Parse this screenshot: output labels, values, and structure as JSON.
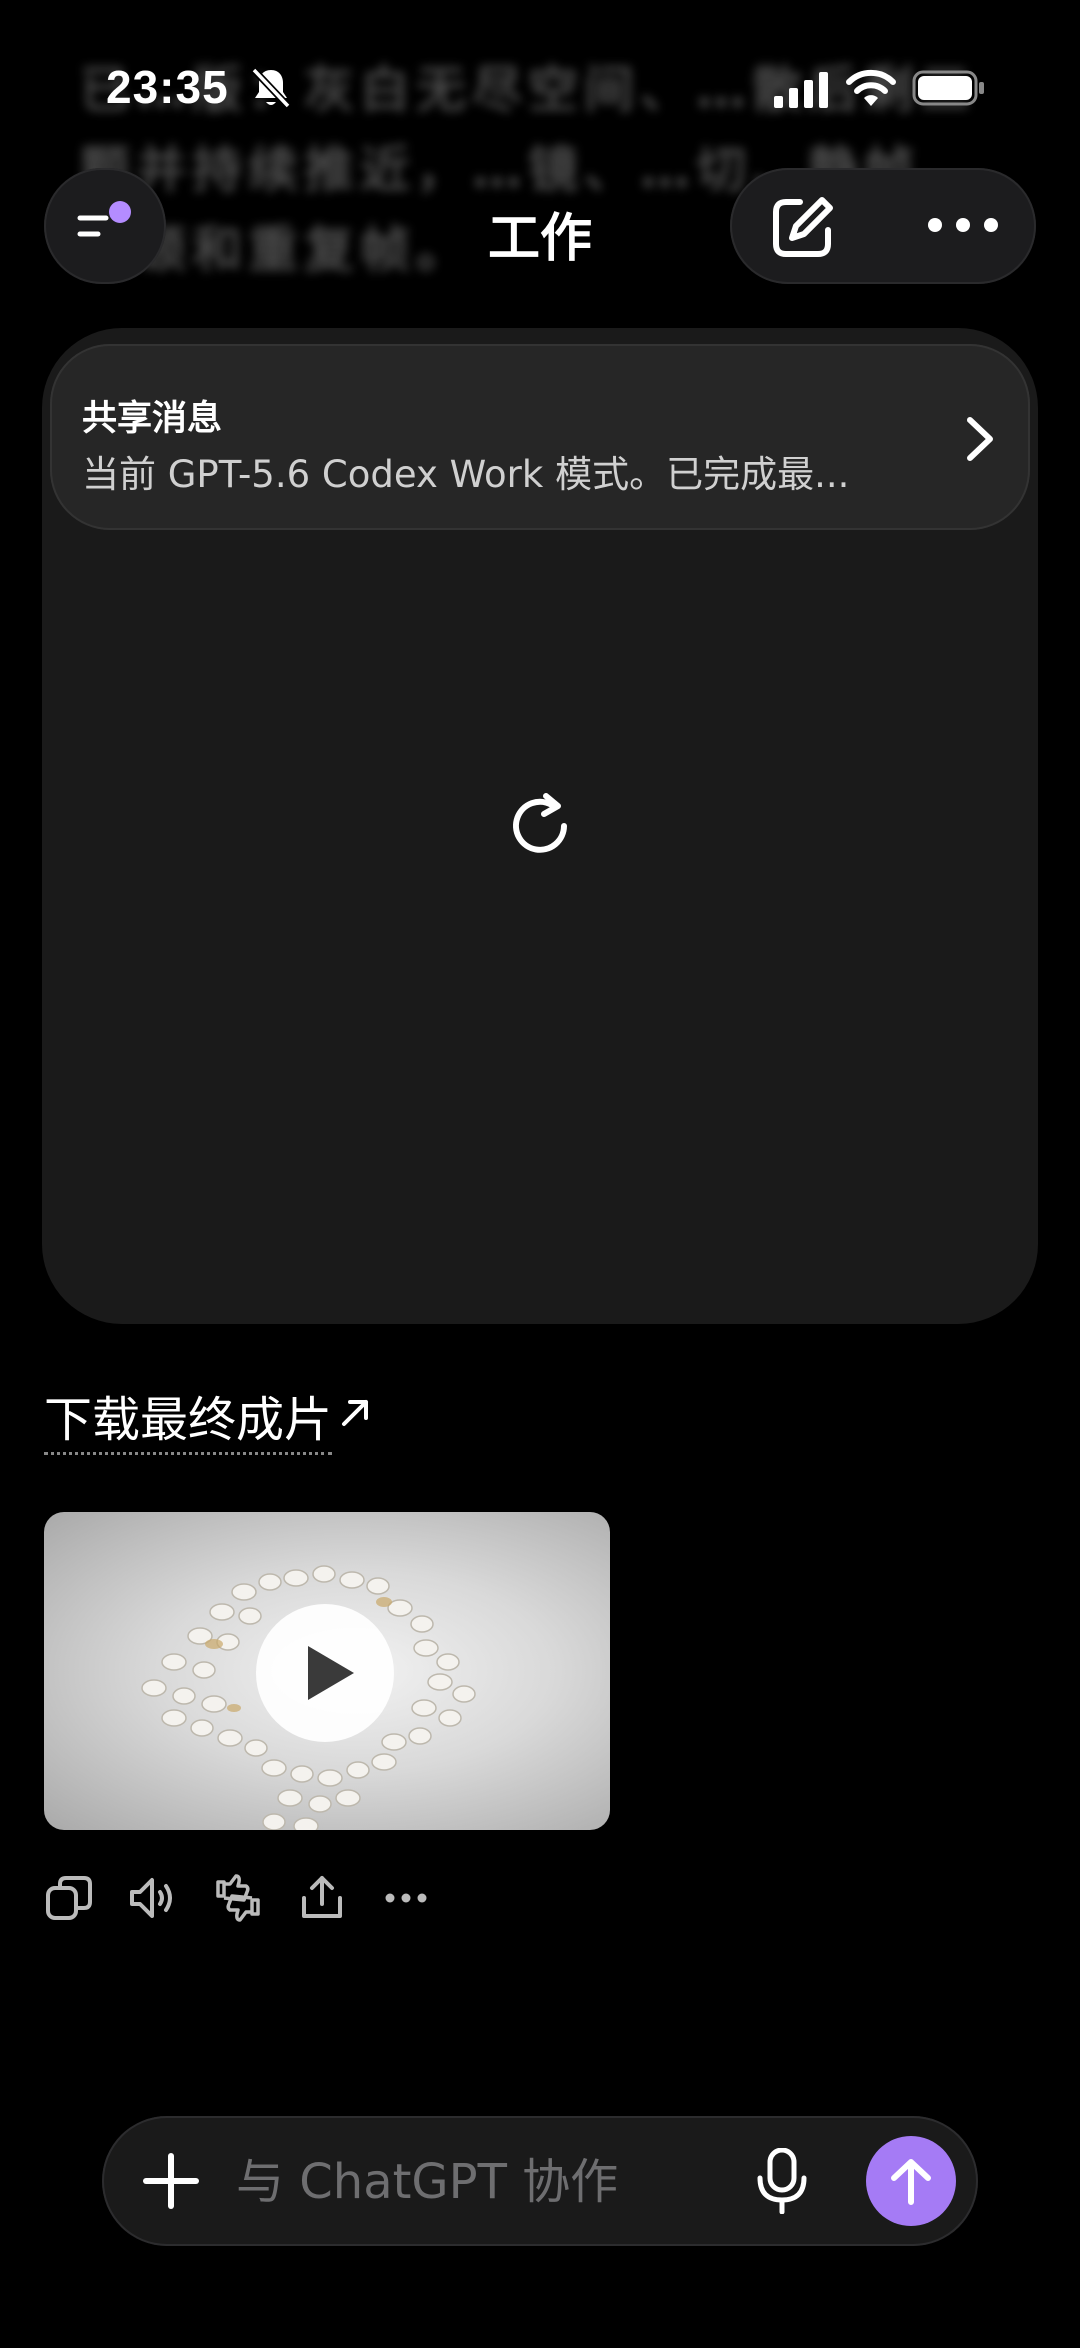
{
  "status_bar": {
    "time": "23:35",
    "icons": [
      "bell-off-icon",
      "signal-icon",
      "wifi-icon",
      "battery-icon"
    ]
  },
  "background_text": "已…版：灰白无尽空间、…散后剩三颗并持续推近，…镜、…切、静帧、卡顿和重复帧。",
  "header": {
    "title": "工作",
    "menu_icon": "menu-icon",
    "compose_icon": "compose-icon",
    "more_icon": "more-icon",
    "accent_color": "#b48cff"
  },
  "shared_message": {
    "title": "共享消息",
    "preview": "当前 GPT-5.6 Codex Work 模式。已完成最..."
  },
  "download": {
    "label": "下载最终成片",
    "icon": "arrow-up-right-icon"
  },
  "actions": [
    "copy-icon",
    "speaker-icon",
    "thumbs-icon",
    "share-icon",
    "more-icon"
  ],
  "composer": {
    "placeholder": "与 ChatGPT 协作",
    "value": "",
    "send_color": "#a57bf5"
  }
}
